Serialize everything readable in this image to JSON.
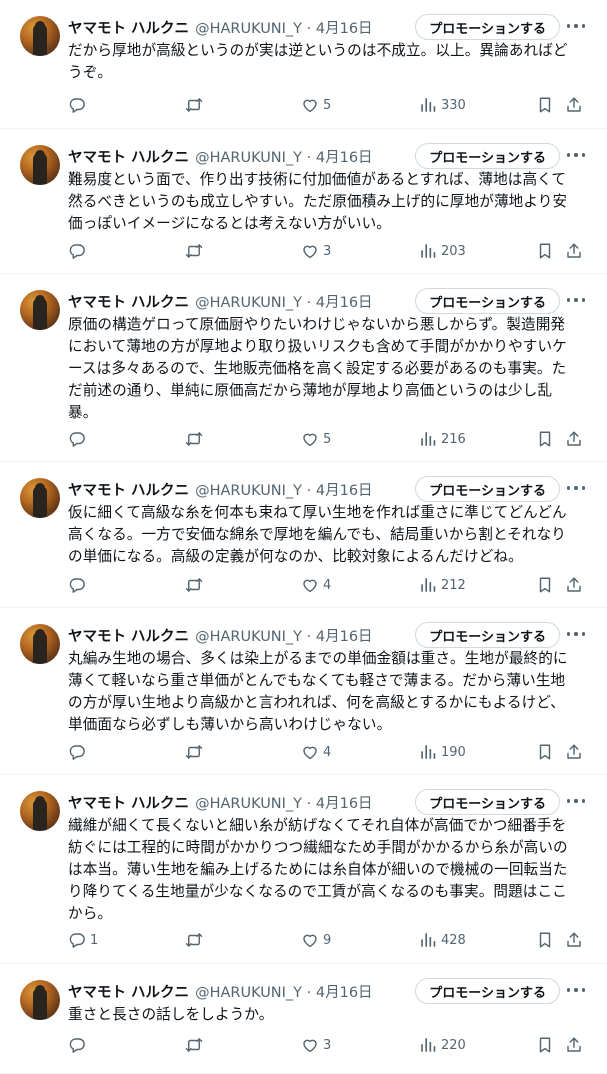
{
  "author": {
    "name": "ヤマモト ハルクニ",
    "handle": "@HARUKUNI_Y · 4月16日"
  },
  "promote_label": "プロモーションする",
  "tweets": [
    {
      "text": "だから厚地が高級というのが実は逆というのは不成立。以上。異論あればど\nうぞ。",
      "replies": "",
      "likes": "5",
      "views": "330"
    },
    {
      "text": "難易度という面で、作り出す技術に付加価値があるとすれば、薄地は高くて\n然るべきというのも成立しやすい。ただ原価積み上げ的に厚地が薄地より安\n価っぽいイメージになるとは考えない方がいい。",
      "replies": "",
      "likes": "3",
      "views": "203"
    },
    {
      "text": "原価の構造ゲロって原価厨やりたいわけじゃないから悪しからず。製造開発\nにおいて薄地の方が厚地より取り扱いリスクも含めて手間がかかりやすいケ\nースは多々あるので、生地販売価格を高く設定する必要があるのも事実。た\nだ前述の通り、単純に原価高だから薄地が厚地より高価というのは少し乱\n暴。",
      "replies": "",
      "likes": "5",
      "views": "216"
    },
    {
      "text": "仮に細くて高級な糸を何本も束ねて厚い生地を作れば重さに準じてどんどん\n高くなる。一方で安価な綿糸で厚地を編んでも、結局重いから割とそれなり\nの単価になる。高級の定義が何なのか、比較対象によるんだけどね。",
      "replies": "",
      "likes": "4",
      "views": "212"
    },
    {
      "text": "丸編み生地の場合、多くは染上がるまでの単価金額は重さ。生地が最終的に\n薄くて軽いなら重さ単価がとんでもなくても軽さで薄まる。だから薄い生地\nの方が厚い生地より高級かと言われれば、何を高級とするかにもよるけど、\n単価面なら必ずしも薄いから高いわけじゃない。",
      "replies": "",
      "likes": "4",
      "views": "190"
    },
    {
      "text": "繊維が細くて長くないと細い糸が紡げなくてそれ自体が高価でかつ細番手を\n紡ぐには工程的に時間がかかりつつ繊細なため手間がかかるから糸が高いの\nは本当。薄い生地を編み上げるためには糸自体が細いので機械の一回転当た\nり降りてくる生地量が少なくなるので工賃が高くなるのも事実。問題はここ\nから。",
      "replies": "1",
      "likes": "9",
      "views": "428"
    },
    {
      "text": "重さと長さの話しをしようか。",
      "replies": "",
      "likes": "3",
      "views": "220"
    }
  ],
  "icons": {
    "reply": "reply-icon",
    "retweet": "retweet-icon",
    "like": "heart-icon",
    "views": "views-icon",
    "bookmark": "bookmark-icon",
    "share": "share-icon",
    "more": "more-icon"
  },
  "colors": {
    "text_primary": "#0f1419",
    "text_secondary": "#536471",
    "divider": "#eff3f4",
    "button_border": "#cfd9de"
  }
}
